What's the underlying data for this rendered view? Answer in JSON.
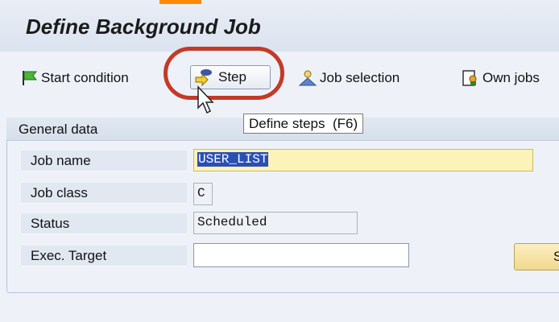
{
  "page_title": "Define Background Job",
  "toolbar": {
    "start_condition": "Start condition",
    "step": "Step",
    "job_selection": "Job selection",
    "own_jobs": "Own jobs"
  },
  "tooltip": "Define steps  (F6)",
  "general_data": {
    "title": "General data",
    "fields": {
      "job_name": {
        "label": "Job name",
        "value": "USER_LIST"
      },
      "job_class": {
        "label": "Job class",
        "value": "C"
      },
      "status": {
        "label": "Status",
        "value": "Scheduled"
      },
      "exec_target": {
        "label": "Exec. Target",
        "value": ""
      }
    },
    "side_button": "S"
  },
  "colors": {
    "highlight_ring": "#c43a27",
    "selection": "#2a4fb5",
    "required_field": "#fdf3b8"
  }
}
